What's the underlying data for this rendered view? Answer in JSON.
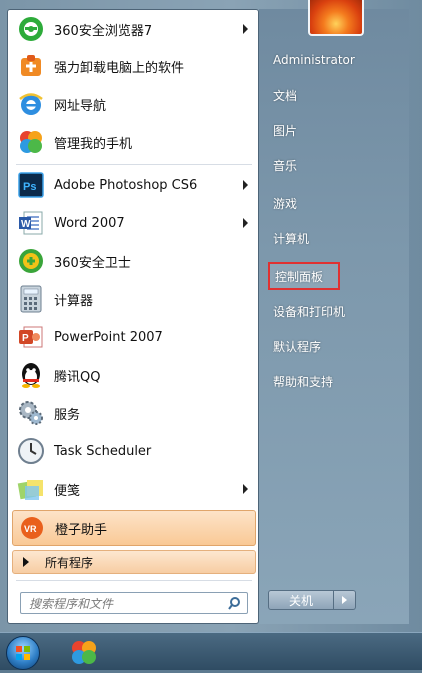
{
  "pinned": [
    {
      "label": "360安全浏览器7",
      "icon": "360-browser-icon",
      "submenu": true
    },
    {
      "label": "强力卸载电脑上的软件",
      "icon": "uninstall-icon",
      "submenu": false
    },
    {
      "label": "网址导航",
      "icon": "ie-icon",
      "submenu": false
    },
    {
      "label": "管理我的手机",
      "icon": "phone-manager-icon",
      "submenu": false
    }
  ],
  "recent": [
    {
      "label": "Adobe Photoshop CS6",
      "icon": "photoshop-icon",
      "submenu": true
    },
    {
      "label": "Word 2007",
      "icon": "word-icon",
      "submenu": true
    },
    {
      "label": "360安全卫士",
      "icon": "360-security-icon",
      "submenu": false
    },
    {
      "label": "计算器",
      "icon": "calculator-icon",
      "submenu": false
    },
    {
      "label": "PowerPoint 2007",
      "icon": "powerpoint-icon",
      "submenu": false
    },
    {
      "label": "腾讯QQ",
      "icon": "qq-icon",
      "submenu": false
    },
    {
      "label": "服务",
      "icon": "services-icon",
      "submenu": false
    },
    {
      "label": "Task Scheduler",
      "icon": "clock-icon",
      "submenu": false
    },
    {
      "label": "便笺",
      "icon": "sticky-notes-icon",
      "submenu": true
    },
    {
      "label": "橙子助手",
      "icon": "orange-assistant-icon",
      "submenu": false
    }
  ],
  "all_programs": "所有程序",
  "search_placeholder": "搜索程序和文件",
  "right": {
    "user": "Administrator",
    "items": [
      "文档",
      "图片",
      "音乐",
      "游戏",
      "计算机",
      "控制面板",
      "设备和打印机",
      "默认程序",
      "帮助和支持"
    ],
    "highlighted": "控制面板"
  },
  "shutdown_label": "关机",
  "colors": {
    "highlight_border": "#e03131",
    "hover_orange": "#f9c996"
  }
}
